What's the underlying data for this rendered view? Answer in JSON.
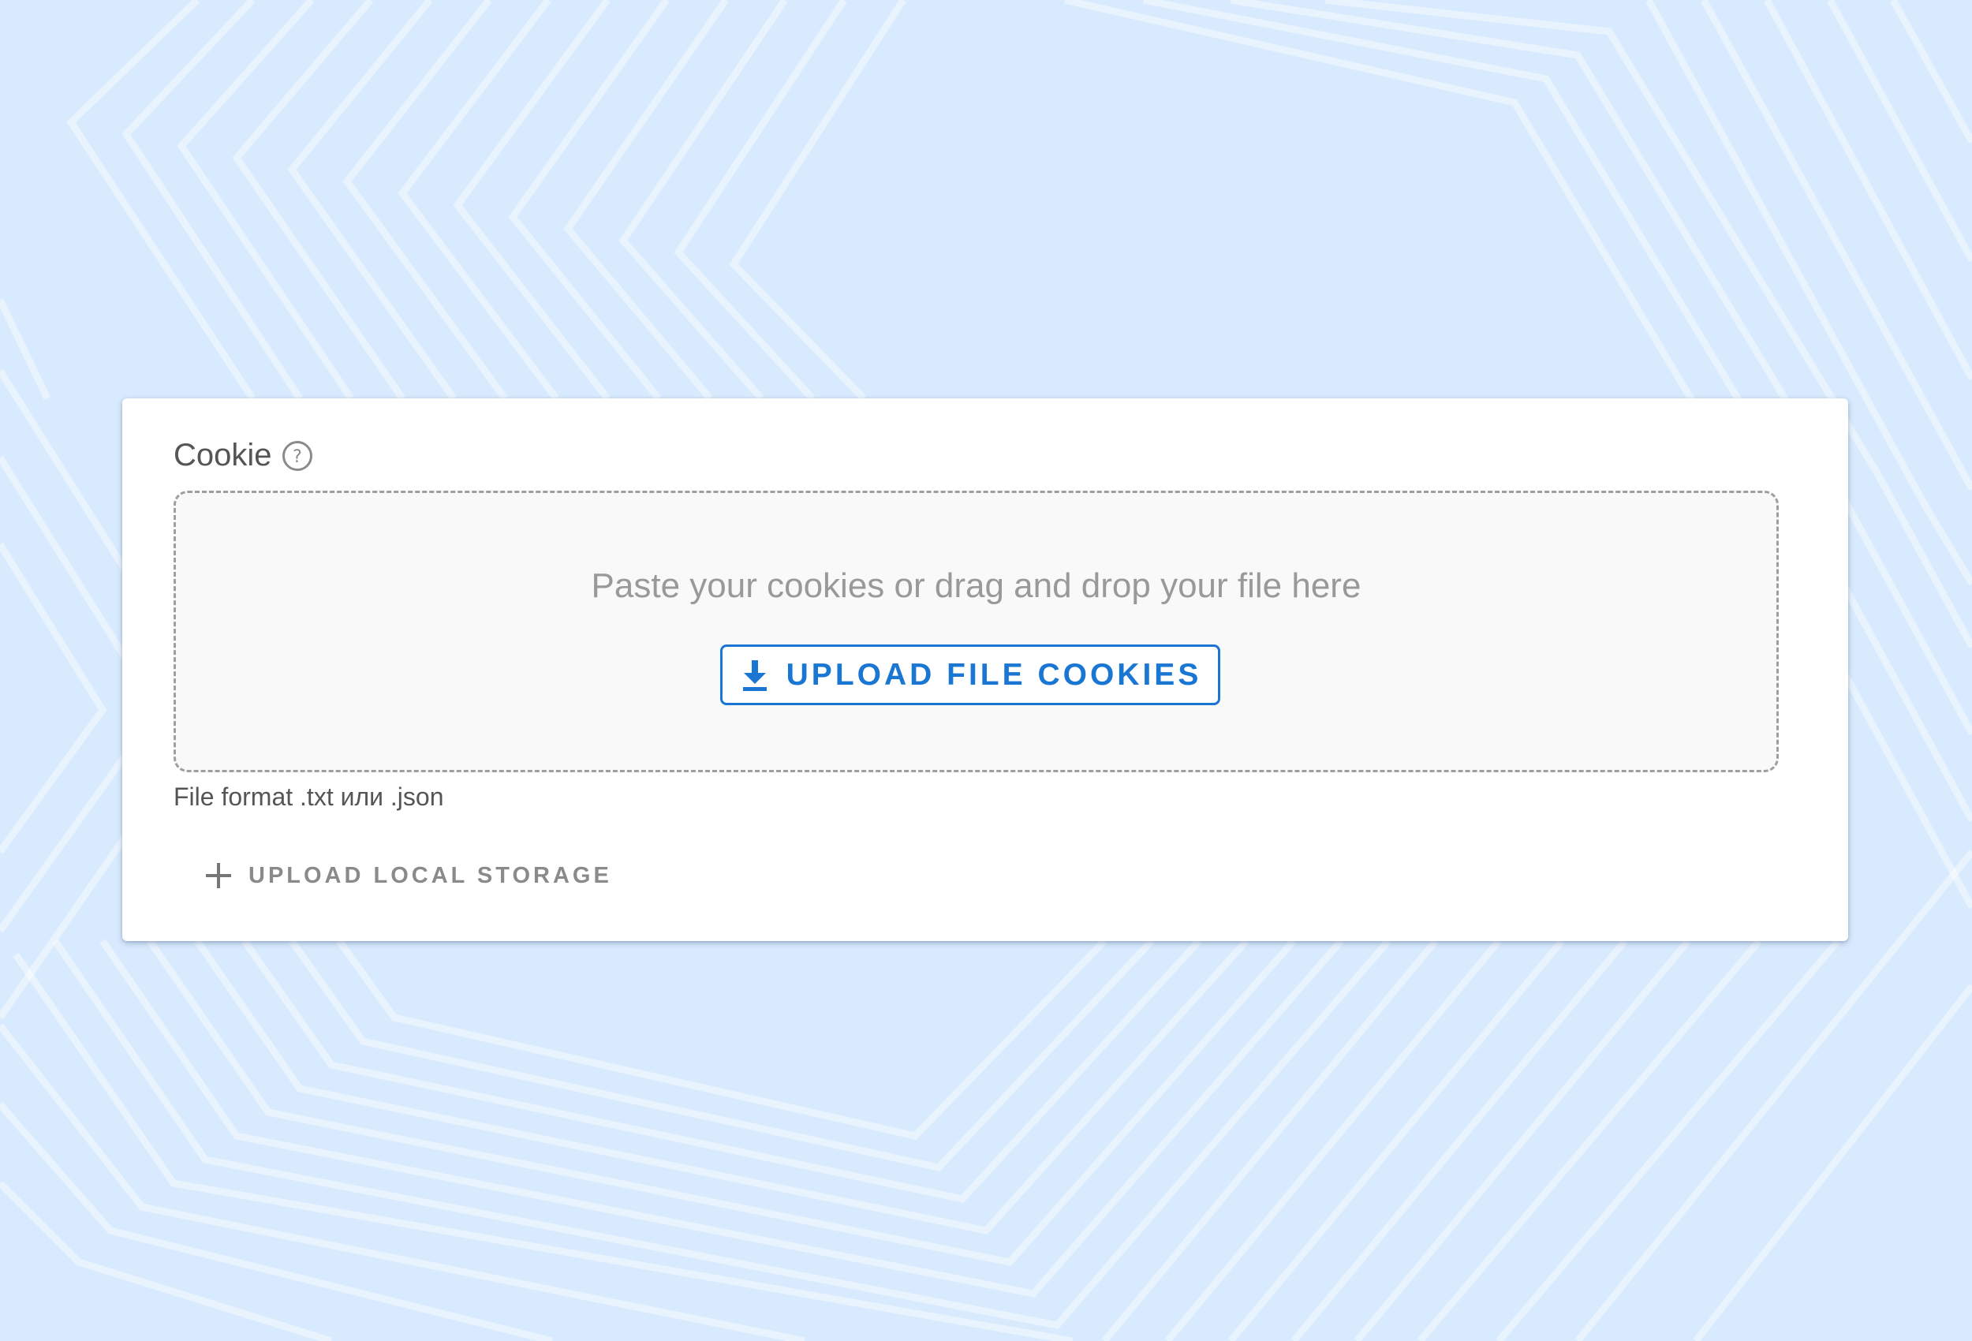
{
  "colors": {
    "background": "#d8eafd",
    "accent": "#1976d2",
    "card": "#ffffff",
    "dropzone_bg": "#f9f9f9"
  },
  "cookie_field": {
    "label": "Cookie",
    "help_icon": "question-circle-icon",
    "dropzone_hint": "Paste your cookies or drag and drop your file here",
    "upload_button_label": "UPLOAD FILE COOKIES",
    "upload_button_icon": "download-icon",
    "format_hint": "File format .txt или .json"
  },
  "local_storage": {
    "button_label": "UPLOAD LOCAL STORAGE",
    "button_icon": "plus-icon"
  }
}
